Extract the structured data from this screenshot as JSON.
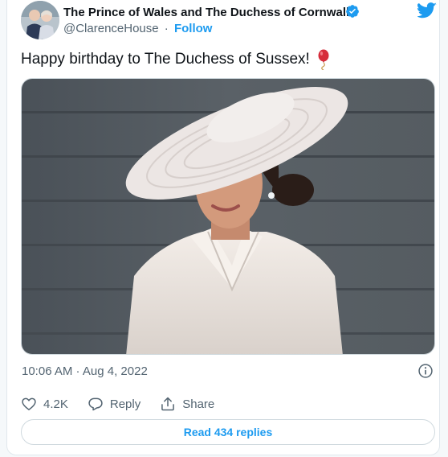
{
  "tweet": {
    "author_name": "The Prince of Wales and The Duchess of Cornwall",
    "handle": "@ClarenceHouse",
    "separator": "·",
    "follow_label": "Follow",
    "text": "Happy birthday to The Duchess of Sussex!",
    "emoji": "balloon",
    "timestamp": "10:06 AM · Aug 4, 2022"
  },
  "actions": {
    "like_count": "4.2K",
    "reply_label": "Reply",
    "share_label": "Share",
    "read_replies_label": "Read 434 replies"
  },
  "colors": {
    "accent": "#1d9bf0",
    "text": "#0f1419",
    "secondary": "#536471"
  },
  "icons": [
    "avatar",
    "verified-badge-icon",
    "twitter-bird-icon",
    "balloon-emoji",
    "info-icon",
    "heart-icon",
    "reply-bubble-icon",
    "share-icon"
  ]
}
